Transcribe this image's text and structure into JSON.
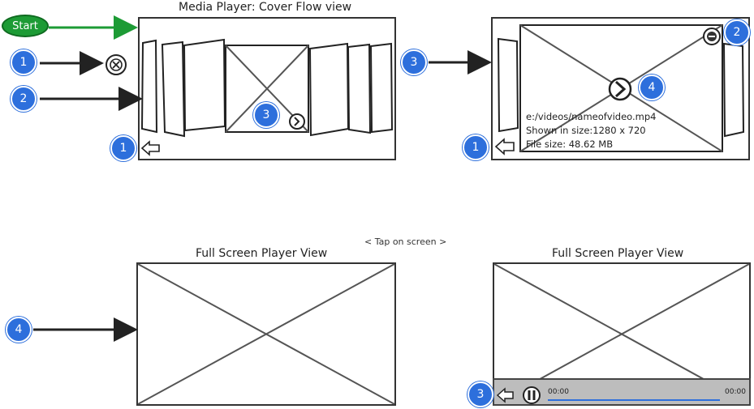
{
  "start": {
    "label": "Start"
  },
  "titles": {
    "cover_flow": "Media Player: Cover Flow view",
    "full_screen_left": "Full Screen Player View",
    "full_screen_right": "Full Screen Player View"
  },
  "tap_note": "< Tap on screen >",
  "video_info": {
    "path": "e:/videos/nameofvideo.mp4",
    "size": "Shown in size:1280 x 720",
    "file_size": "File size: 48.62 MB"
  },
  "controls": {
    "time_start": "00:00",
    "time_end": "00:00"
  },
  "badges": {
    "b1_left": "1",
    "b2_left": "2",
    "b3_cover": "3",
    "b1_cover": "1",
    "b3_right": "3",
    "b2_detail": "2",
    "b4_detail": "4",
    "b1_detail": "1",
    "b4_left": "4",
    "b3_fullscreen": "3"
  },
  "colors": {
    "badge": "#2d6fdc",
    "start": "#1d9b35",
    "arrow_start": "#1d9b35",
    "arrow": "#222222"
  }
}
